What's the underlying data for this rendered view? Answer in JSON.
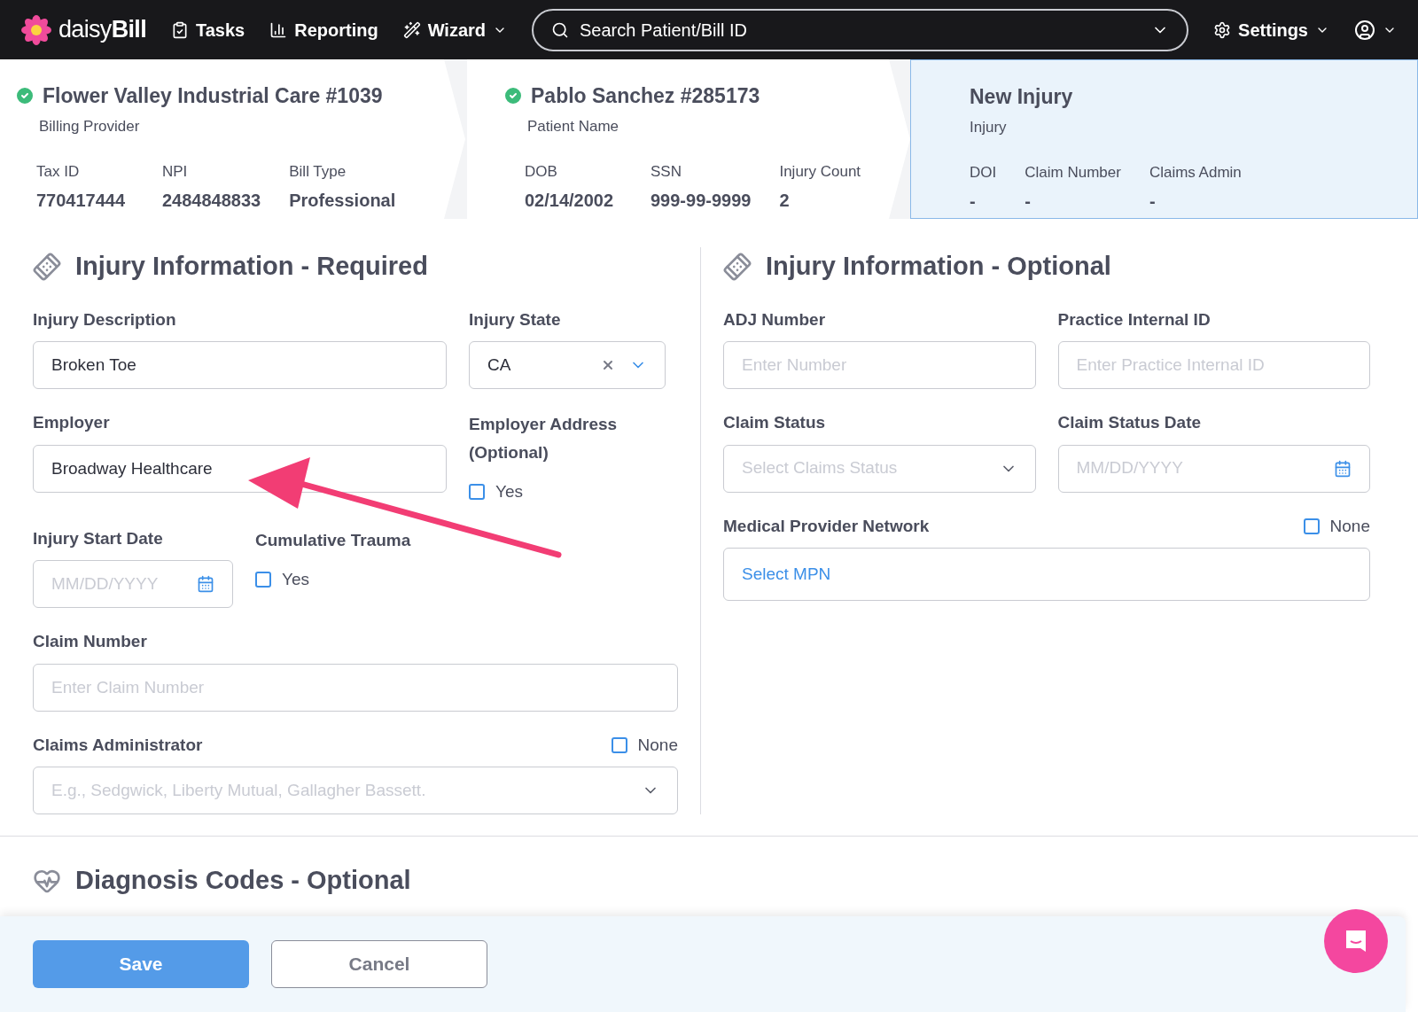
{
  "nav": {
    "logo_light": "daisy",
    "logo_bold": "Bill",
    "items": [
      {
        "kind": "tasks",
        "label": "Tasks"
      },
      {
        "kind": "reporting",
        "label": "Reporting"
      },
      {
        "kind": "wizard",
        "label": "Wizard"
      }
    ],
    "search": {
      "placeholder": "Search Patient/Bill ID"
    },
    "settings": "Settings"
  },
  "steps": [
    {
      "title": "Flower Valley Industrial Care #1039",
      "subtitle": "Billing Provider",
      "verified": true,
      "selected": false,
      "fields": [
        {
          "label": "Tax ID",
          "value": "770417444"
        },
        {
          "label": "NPI",
          "value": "2484848833"
        },
        {
          "label": "Bill Type",
          "value": "Professional"
        }
      ]
    },
    {
      "title": "Pablo Sanchez #285173",
      "subtitle": "Patient Name",
      "verified": true,
      "selected": false,
      "fields": [
        {
          "label": "DOB",
          "value": "02/14/2002"
        },
        {
          "label": "SSN",
          "value": "999-99-9999"
        },
        {
          "label": "Injury Count",
          "value": "2"
        }
      ]
    },
    {
      "title": "New Injury",
      "subtitle": "Injury",
      "verified": false,
      "selected": true,
      "fields": [
        {
          "label": "DOI",
          "value": "-"
        },
        {
          "label": "Claim Number",
          "value": "-"
        },
        {
          "label": "Claims Admin",
          "value": "-"
        }
      ]
    }
  ],
  "sections": [
    {
      "title": "Injury Information - Required",
      "rows": [
        [
          {
            "kind": "text",
            "label": "Injury Description",
            "value": "Broken Toe"
          },
          {
            "kind": "select",
            "label": "Injury State",
            "value": "CA",
            "clearable": true
          }
        ],
        [
          {
            "kind": "text",
            "label": "Employer",
            "value": "Broadway Healthcare"
          },
          {
            "kind": "checkbox",
            "label": "Employer Address (Optional)",
            "option": "Yes",
            "checked": false
          }
        ],
        [
          {
            "kind": "date",
            "label": "Injury Start Date",
            "placeholder": "MM/DD/YYYY"
          },
          {
            "kind": "checkbox",
            "label": "Cumulative Trauma",
            "option": "Yes",
            "checked": false
          }
        ],
        [
          {
            "kind": "text",
            "label": "Claim Number",
            "placeholder": "Enter Claim Number"
          }
        ],
        [
          {
            "kind": "select",
            "label": "Claims Administrator",
            "placeholder": "E.g., Sedgwick, Liberty Mutual, Gallagher Bassett.",
            "none": {
              "label": "None",
              "checked": false
            }
          }
        ]
      ]
    },
    {
      "title": "Injury Information - Optional",
      "rows": [
        [
          {
            "kind": "text",
            "label": "ADJ Number",
            "placeholder": "Enter Number"
          },
          {
            "kind": "text",
            "label": "Practice Internal ID",
            "placeholder": "Enter Practice Internal ID"
          }
        ],
        [
          {
            "kind": "select",
            "label": "Claim Status",
            "placeholder": "Select Claims Status"
          },
          {
            "kind": "date",
            "label": "Claim Status Date",
            "placeholder": "MM/DD/YYYY"
          }
        ],
        [
          {
            "kind": "link",
            "label": "Medical Provider Network",
            "value": "Select MPN",
            "none": {
              "label": "None",
              "checked": false
            }
          }
        ]
      ]
    }
  ],
  "next_section": "Diagnosis Codes - Optional",
  "buttons": {
    "save": "Save",
    "cancel": "Cancel"
  }
}
